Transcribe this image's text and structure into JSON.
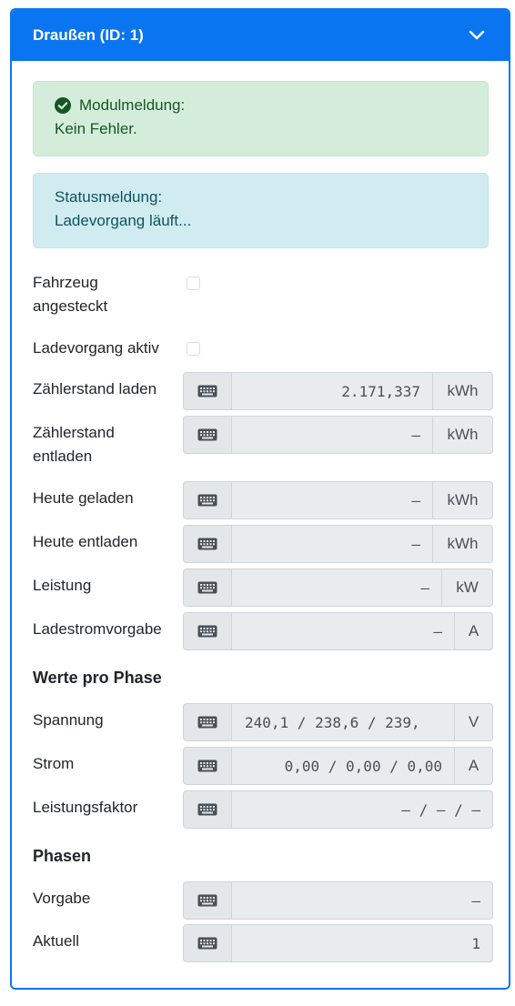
{
  "card": {
    "title": "Draußen (ID: 1)",
    "accent": "#0a75f0"
  },
  "alerts": {
    "module": {
      "title": "Modulmeldung:",
      "text": "Kein Fehler.",
      "icon": "check-circle-icon",
      "color": "#155724"
    },
    "status": {
      "title": "Statusmeldung:",
      "text": "Ladevorgang läuft..."
    }
  },
  "checkboxes": {
    "plugged": {
      "label_line1": "Fahrzeug",
      "label_line2": "angesteckt",
      "checked": false
    },
    "charging": {
      "label": "Ladevorgang aktiv",
      "checked": false
    }
  },
  "fields": {
    "meter_charge": {
      "label": "Zählerstand laden",
      "value": "2.171,337",
      "unit": "kWh"
    },
    "meter_discharge": {
      "label_line1": "Zählerstand",
      "label_line2": "entladen",
      "value": "–",
      "unit": "kWh"
    },
    "today_charged": {
      "label": "Heute geladen",
      "value": "–",
      "unit": "kWh"
    },
    "today_discharged": {
      "label": "Heute entladen",
      "value": "–",
      "unit": "kWh"
    },
    "power": {
      "label": "Leistung",
      "value": "–",
      "unit": "kW"
    },
    "current_target": {
      "label": "Ladestromvorgabe",
      "value": "–",
      "unit": "A"
    }
  },
  "phase_values": {
    "heading": "Werte pro Phase",
    "voltage": {
      "label": "Spannung",
      "value": "240,1 / 238,6 / 239,",
      "unit": "V"
    },
    "current": {
      "label": "Strom",
      "value": "0,00 / 0,00 / 0,00",
      "unit": "A"
    },
    "power_factor": {
      "label": "Leistungsfaktor",
      "value": "– / – / –"
    }
  },
  "phases": {
    "heading": "Phasen",
    "target": {
      "label": "Vorgabe",
      "value": "–"
    },
    "actual": {
      "label": "Aktuell",
      "value": "1"
    }
  },
  "icons": {
    "keyboard": "keyboard-icon",
    "chevron": "chevron-down-icon"
  }
}
